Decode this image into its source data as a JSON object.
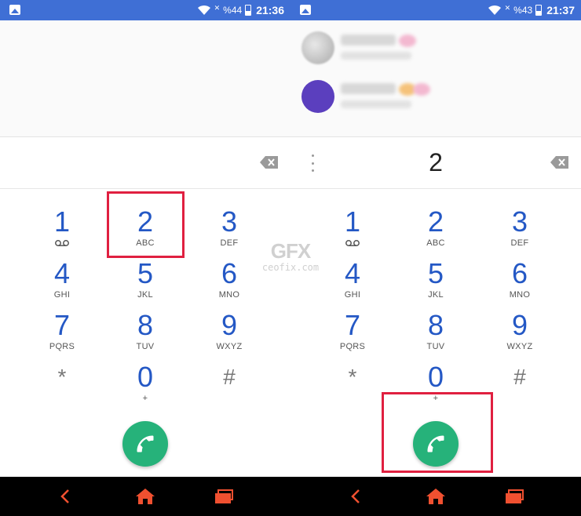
{
  "left_screen": {
    "status": {
      "battery": "%44",
      "time": "21:36"
    },
    "display": {
      "digits": ""
    },
    "highlight": "key-2"
  },
  "right_screen": {
    "status": {
      "battery": "%43",
      "time": "21:37"
    },
    "display": {
      "digits": "2"
    },
    "contacts": [
      {
        "avatar_color": "#5b3fbe"
      },
      {
        "avatar_color": "#5b3fbe"
      }
    ],
    "highlight": "call-button"
  },
  "keypad": [
    {
      "num": "1",
      "sub": ""
    },
    {
      "num": "2",
      "sub": "ABC"
    },
    {
      "num": "3",
      "sub": "DEF"
    },
    {
      "num": "4",
      "sub": "GHI"
    },
    {
      "num": "5",
      "sub": "JKL"
    },
    {
      "num": "6",
      "sub": "MNO"
    },
    {
      "num": "7",
      "sub": "PQRS"
    },
    {
      "num": "8",
      "sub": "TUV"
    },
    {
      "num": "9",
      "sub": "WXYZ"
    },
    {
      "num": "*",
      "sub": ""
    },
    {
      "num": "0",
      "sub": "+"
    },
    {
      "num": "#",
      "sub": ""
    }
  ],
  "icons": {
    "voicemail": "voicemail-icon",
    "backspace": "backspace-icon",
    "call": "phone-icon",
    "back": "back-icon",
    "home": "home-icon",
    "recents": "recents-icon"
  },
  "watermark": {
    "logo": "GFX",
    "site": "ceofix.com"
  },
  "colors": {
    "status_bar": "#3f6fd5",
    "digit_blue": "#2458c5",
    "call_green": "#26b27a",
    "nav_accent": "#f05030",
    "highlight_red": "#e02040"
  }
}
